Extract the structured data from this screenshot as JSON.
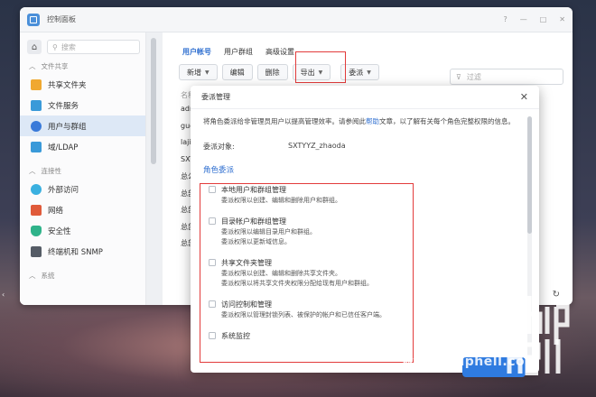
{
  "window": {
    "title": "控制面板",
    "controls": [
      "?",
      "—",
      "□",
      "✕"
    ]
  },
  "sidebar": {
    "search_placeholder": "搜索",
    "sections": [
      {
        "label": "文件共享"
      },
      {
        "label": "连接性"
      },
      {
        "label": "系统"
      }
    ],
    "items": [
      {
        "label": "共享文件夹",
        "color": "#f0a830"
      },
      {
        "label": "文件服务",
        "color": "#3a9ad9"
      },
      {
        "label": "用户与群组",
        "color": "#3a7ad9"
      },
      {
        "label": "域/LDAP",
        "color": "#3a9ad9"
      },
      {
        "label": "外部访问",
        "color": "#3ab0e0"
      },
      {
        "label": "网络",
        "color": "#e05a3a"
      },
      {
        "label": "安全性",
        "color": "#2fb38a"
      },
      {
        "label": "终端机和 SNMP",
        "color": "#555c66"
      }
    ]
  },
  "main": {
    "tabs": [
      {
        "label": "用户帐号",
        "active": true
      },
      {
        "label": "用户群组",
        "active": false
      },
      {
        "label": "高级设置",
        "active": false
      }
    ],
    "toolbar": {
      "new": "新增",
      "edit": "编辑",
      "delete": "删除",
      "export": "导出",
      "delegate": "委派"
    },
    "filter_placeholder": "过滤",
    "list_header": "名称",
    "users": [
      "admin",
      "guest",
      "lajilaoni",
      "SXTYYZ",
      "总公司",
      "总部人",
      "总部明",
      "总部刘",
      "总部赵"
    ]
  },
  "dialog": {
    "title": "委派管理",
    "intro_before": "将角色委派给非管理员用户以提高管理效率。请参阅此",
    "intro_link": "帮助",
    "intro_after": "文章，以了解有关每个角色完整权限的信息。",
    "delegate_label": "委派对象:",
    "delegate_value": "SXTYYZ_zhaoda",
    "section_title": "角色委派",
    "roles": [
      {
        "name": "本地用户和群组管理",
        "desc": [
          "委派权限以创建、编辑和删除用户和群组。"
        ]
      },
      {
        "name": "目录帐户和群组管理",
        "desc": [
          "委派权限以编辑目录用户和群组。",
          "委派权限以更新域信息。"
        ]
      },
      {
        "name": "共享文件夹管理",
        "desc": [
          "委派权限以创建、编辑和删除共享文件夹。",
          "委派权限以将共享文件夹权限分配给现有用户和群组。"
        ]
      },
      {
        "name": "访问控制和管理",
        "desc": [
          "委派权限以管理封锁列表、被保护的帐户和已信任客户端。"
        ]
      },
      {
        "name": "系统监控",
        "desc": []
      }
    ]
  },
  "watermark": "www.chiphell.com",
  "colors": {
    "accent": "#2f7be0",
    "highlight": "#e23b3b"
  }
}
